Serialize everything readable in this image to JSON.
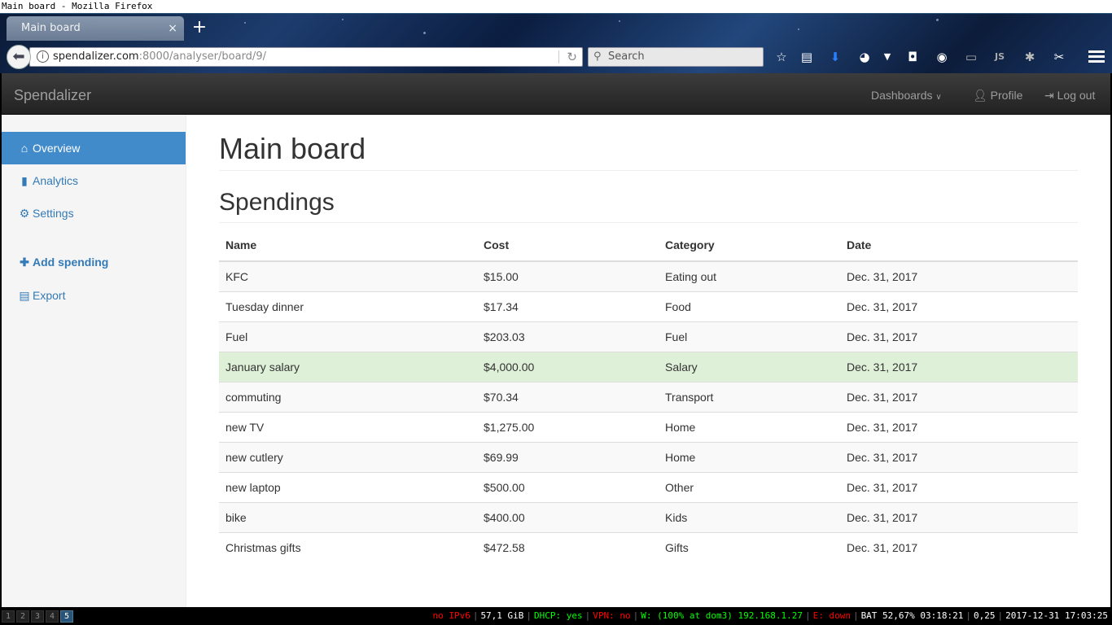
{
  "window_title": "Main board - Mozilla Firefox",
  "browser": {
    "tab_title": "Main board",
    "tab_close": "×",
    "new_tab": "+",
    "url_host": "spendalizer.com",
    "url_path": ":8000/analyser/board/9/",
    "search_placeholder": "Search",
    "toolbar_icons": [
      "bookmark-star-icon",
      "reading-list-icon",
      "downloads-icon",
      "palette-icon",
      "dropdown-arrow-icon",
      "pocket-icon",
      "extension-icon",
      "screen-icon",
      "js-icon",
      "gear-extension-icon",
      "tools-icon"
    ]
  },
  "app": {
    "brand": "Spendalizer",
    "nav": {
      "dashboards": "Dashboards",
      "profile": "Profile",
      "logout": "Log out"
    },
    "sidebar": [
      {
        "label": "Overview",
        "icon": "home-icon",
        "glyph": "⌂"
      },
      {
        "label": "Analytics",
        "icon": "bar-chart-icon",
        "glyph": "▮"
      },
      {
        "label": "Settings",
        "icon": "gear-icon",
        "glyph": "⚙"
      },
      {
        "label": "Add spending",
        "icon": "plus-icon",
        "glyph": "✚"
      },
      {
        "label": "Export",
        "icon": "file-icon",
        "glyph": "▤"
      }
    ],
    "page_title": "Main board",
    "section_title": "Spendings",
    "table": {
      "headers": [
        "Name",
        "Cost",
        "Category",
        "Date"
      ],
      "rows": [
        [
          "KFC",
          "$15.00",
          "Eating out",
          "Dec. 31, 2017"
        ],
        [
          "Tuesday dinner",
          "$17.34",
          "Food",
          "Dec. 31, 2017"
        ],
        [
          "Fuel",
          "$203.03",
          "Fuel",
          "Dec. 31, 2017"
        ],
        [
          "January salary",
          "$4,000.00",
          "Salary",
          "Dec. 31, 2017"
        ],
        [
          "commuting",
          "$70.34",
          "Transport",
          "Dec. 31, 2017"
        ],
        [
          "new TV",
          "$1,275.00",
          "Home",
          "Dec. 31, 2017"
        ],
        [
          "new cutlery",
          "$69.99",
          "Home",
          "Dec. 31, 2017"
        ],
        [
          "new laptop",
          "$500.00",
          "Other",
          "Dec. 31, 2017"
        ],
        [
          "bike",
          "$400.00",
          "Kids",
          "Dec. 31, 2017"
        ],
        [
          "Christmas gifts",
          "$472.58",
          "Gifts",
          "Dec. 31, 2017"
        ]
      ]
    }
  },
  "statusbar": {
    "workspaces": [
      "1",
      "2",
      "3",
      "4",
      "5"
    ],
    "active_workspace": "5",
    "items": [
      {
        "text": "no IPv6",
        "color": "#ff0000"
      },
      {
        "text": "57,1 GiB",
        "color": "#ffffff"
      },
      {
        "text": "DHCP: yes",
        "color": "#00ff00"
      },
      {
        "text": "VPN: no",
        "color": "#ff0000"
      },
      {
        "text": "W: (100% at dom3) 192.168.1.27",
        "color": "#00ff00"
      },
      {
        "text": "E: down",
        "color": "#ff0000"
      },
      {
        "text": "BAT 52,67% 03:18:21",
        "color": "#ffffff"
      },
      {
        "text": "0,25",
        "color": "#ffffff"
      },
      {
        "text": "2017-12-31 17:03:25",
        "color": "#ffffff"
      }
    ]
  },
  "colors": {
    "active_sidebar": "#428bca",
    "link": "#337ab7",
    "navbar": "#222222",
    "success_row": "#dff0d8"
  }
}
